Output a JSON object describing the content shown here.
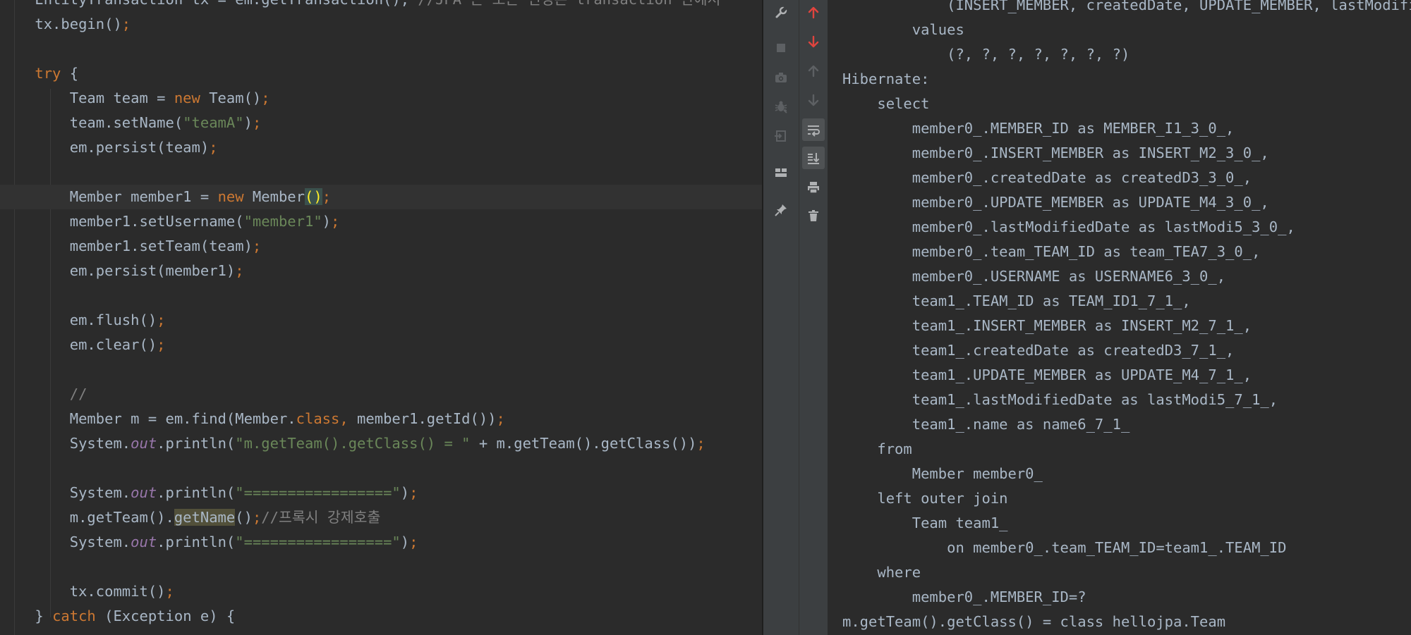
{
  "editor": {
    "lines": [
      [
        {
          "t": "    EntityTransaction tx = em.getTransaction(); ",
          "c": ""
        },
        {
          "t": "//JPA 는 모든 변경은 transaction 안에서",
          "c": "cmt"
        }
      ],
      [
        {
          "t": "    tx.begin()",
          "c": ""
        },
        {
          "t": ";",
          "c": "kw"
        }
      ],
      [
        {
          "t": "",
          "c": ""
        }
      ],
      [
        {
          "t": "    ",
          "c": ""
        },
        {
          "t": "try",
          "c": "kw"
        },
        {
          "t": " {",
          "c": ""
        }
      ],
      [
        {
          "t": "        Team team = ",
          "c": ""
        },
        {
          "t": "new",
          "c": "kw"
        },
        {
          "t": " Team()",
          "c": ""
        },
        {
          "t": ";",
          "c": "kw"
        }
      ],
      [
        {
          "t": "        team.setName(",
          "c": ""
        },
        {
          "t": "\"teamA\"",
          "c": "str"
        },
        {
          "t": ")",
          "c": ""
        },
        {
          "t": ";",
          "c": "kw"
        }
      ],
      [
        {
          "t": "        em.persist(team)",
          "c": ""
        },
        {
          "t": ";",
          "c": "kw"
        }
      ],
      [
        {
          "t": "",
          "c": ""
        }
      ],
      [
        {
          "t": "        Member member1 = ",
          "c": ""
        },
        {
          "t": "new",
          "c": "kw"
        },
        {
          "t": " Member",
          "c": ""
        },
        {
          "t": "()",
          "c": "paren-hl"
        },
        {
          "t": ";",
          "c": "kw"
        }
      ],
      [
        {
          "t": "        member1.setUsername(",
          "c": ""
        },
        {
          "t": "\"member1\"",
          "c": "str"
        },
        {
          "t": ")",
          "c": ""
        },
        {
          "t": ";",
          "c": "kw"
        }
      ],
      [
        {
          "t": "        member1.setTeam(team)",
          "c": ""
        },
        {
          "t": ";",
          "c": "kw"
        }
      ],
      [
        {
          "t": "        em.persist(member1)",
          "c": ""
        },
        {
          "t": ";",
          "c": "kw"
        }
      ],
      [
        {
          "t": "",
          "c": ""
        }
      ],
      [
        {
          "t": "        em.flush()",
          "c": ""
        },
        {
          "t": ";",
          "c": "kw"
        }
      ],
      [
        {
          "t": "        em.clear()",
          "c": ""
        },
        {
          "t": ";",
          "c": "kw"
        }
      ],
      [
        {
          "t": "",
          "c": ""
        }
      ],
      [
        {
          "t": "        //",
          "c": "cmt"
        }
      ],
      [
        {
          "t": "        Member m = em.find(Member.",
          "c": ""
        },
        {
          "t": "class",
          "c": "kw"
        },
        {
          "t": ", ",
          "c": "kw"
        },
        {
          "t": "member1.getId())",
          "c": ""
        },
        {
          "t": ";",
          "c": "kw"
        }
      ],
      [
        {
          "t": "        System.",
          "c": ""
        },
        {
          "t": "out",
          "c": "fld"
        },
        {
          "t": ".println(",
          "c": ""
        },
        {
          "t": "\"m.getTeam().getClass() = \"",
          "c": "str"
        },
        {
          "t": " + m.getTeam().getClass())",
          "c": ""
        },
        {
          "t": ";",
          "c": "kw"
        }
      ],
      [
        {
          "t": "",
          "c": ""
        }
      ],
      [
        {
          "t": "        System.",
          "c": ""
        },
        {
          "t": "out",
          "c": "fld"
        },
        {
          "t": ".println(",
          "c": ""
        },
        {
          "t": "\"=================\"",
          "c": "str"
        },
        {
          "t": ")",
          "c": ""
        },
        {
          "t": ";",
          "c": "kw"
        }
      ],
      [
        {
          "t": "        m.getTeam().",
          "c": ""
        },
        {
          "t": "getName",
          "c": "usage-hl"
        },
        {
          "t": "()",
          "c": ""
        },
        {
          "t": ";",
          "c": "kw"
        },
        {
          "t": "//프록시 강제호출",
          "c": "cmt"
        }
      ],
      [
        {
          "t": "        System.",
          "c": ""
        },
        {
          "t": "out",
          "c": "fld"
        },
        {
          "t": ".println(",
          "c": ""
        },
        {
          "t": "\"=================\"",
          "c": "str"
        },
        {
          "t": ")",
          "c": ""
        },
        {
          "t": ";",
          "c": "kw"
        }
      ],
      [
        {
          "t": "",
          "c": ""
        }
      ],
      [
        {
          "t": "        tx.commit()",
          "c": ""
        },
        {
          "t": ";",
          "c": "kw"
        }
      ],
      [
        {
          "t": "    } ",
          "c": ""
        },
        {
          "t": "catch",
          "c": "kw"
        },
        {
          "t": " (Exception e) {",
          "c": ""
        }
      ]
    ],
    "current_line": 8
  },
  "toolbar": {
    "left": [
      {
        "name": "settings-wrench-icon",
        "icon": "wrench",
        "color": "#afb1b3",
        "toggled": false,
        "interactable": true
      },
      {
        "name": "stop-icon",
        "icon": "stop",
        "color": "#5d6063",
        "toggled": false,
        "interactable": false
      },
      {
        "name": "camera-icon",
        "icon": "camera",
        "color": "#5d6063",
        "toggled": false,
        "interactable": false
      },
      {
        "name": "debug-bug-icon",
        "icon": "bug",
        "color": "#5d6063",
        "toggled": false,
        "interactable": false
      },
      {
        "name": "exit-icon",
        "icon": "exit",
        "color": "#5d6063",
        "toggled": false,
        "interactable": false
      },
      {
        "name": "layout-icon",
        "icon": "layout",
        "color": "#afb1b3",
        "toggled": false,
        "interactable": true
      },
      {
        "name": "pin-icon",
        "icon": "pin",
        "color": "#afb1b3",
        "toggled": false,
        "interactable": true
      }
    ],
    "right": [
      {
        "name": "up-stack-trace-icon",
        "icon": "arrow-up",
        "color": "#e0443e",
        "toggled": false,
        "interactable": true
      },
      {
        "name": "down-stack-trace-icon",
        "icon": "arrow-down",
        "color": "#e0443e",
        "toggled": false,
        "interactable": true
      },
      {
        "name": "previous-occurrence-icon",
        "icon": "arrow-up",
        "color": "#5d6063",
        "toggled": false,
        "interactable": false
      },
      {
        "name": "next-occurrence-icon",
        "icon": "arrow-down",
        "color": "#5d6063",
        "toggled": false,
        "interactable": false
      },
      {
        "name": "soft-wrap-icon",
        "icon": "wrap",
        "color": "#afb1b3",
        "toggled": true,
        "interactable": true
      },
      {
        "name": "scroll-to-end-icon",
        "icon": "scroll-end",
        "color": "#afb1b3",
        "toggled": true,
        "interactable": true
      },
      {
        "name": "print-icon",
        "icon": "print",
        "color": "#afb1b3",
        "toggled": false,
        "interactable": true
      },
      {
        "name": "trash-icon",
        "icon": "trash",
        "color": "#afb1b3",
        "toggled": false,
        "interactable": true
      }
    ]
  },
  "console": {
    "lines": [
      "            (INSERT_MEMBER, createdDate, UPDATE_MEMBER, lastModifiedDate, team_TEAM_ID, USERNAME, MEMBER_ID)",
      "        values",
      "            (?, ?, ?, ?, ?, ?, ?)",
      "Hibernate: ",
      "    select",
      "        member0_.MEMBER_ID as MEMBER_I1_3_0_,",
      "        member0_.INSERT_MEMBER as INSERT_M2_3_0_,",
      "        member0_.createdDate as createdD3_3_0_,",
      "        member0_.UPDATE_MEMBER as UPDATE_M4_3_0_,",
      "        member0_.lastModifiedDate as lastModi5_3_0_,",
      "        member0_.team_TEAM_ID as team_TEA7_3_0_,",
      "        member0_.USERNAME as USERNAME6_3_0_,",
      "        team1_.TEAM_ID as TEAM_ID1_7_1_,",
      "        team1_.INSERT_MEMBER as INSERT_M2_7_1_,",
      "        team1_.createdDate as createdD3_7_1_,",
      "        team1_.UPDATE_MEMBER as UPDATE_M4_7_1_,",
      "        team1_.lastModifiedDate as lastModi5_7_1_,",
      "        team1_.name as name6_7_1_ ",
      "    from",
      "        Member member0_ ",
      "    left outer join",
      "        Team team1_ ",
      "            on member0_.team_TEAM_ID=team1_.TEAM_ID ",
      "    where",
      "        member0_.MEMBER_ID=?",
      "m.getTeam().getClass() = class hellojpa.Team"
    ]
  }
}
